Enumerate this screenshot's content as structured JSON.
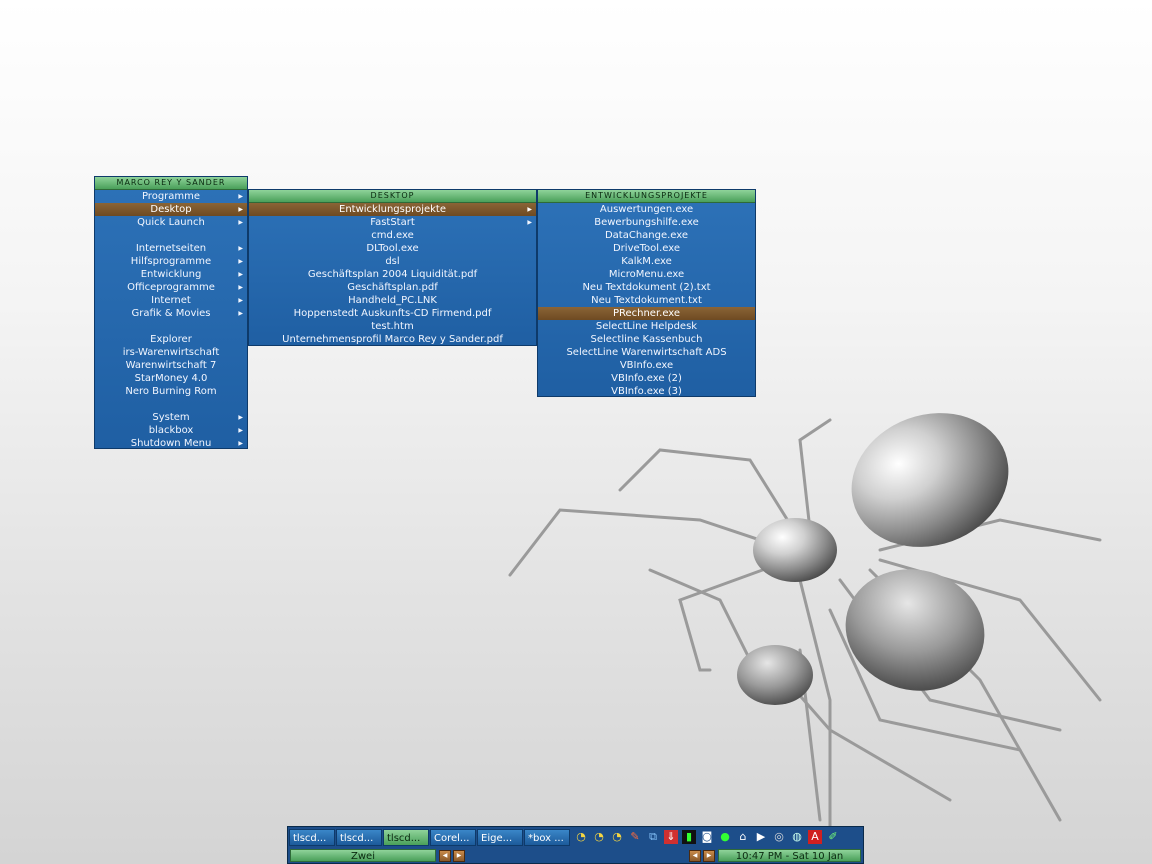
{
  "root_menu": {
    "title": "MARCO REY Y SANDER",
    "items": [
      {
        "label": "Programme",
        "submenu": true
      },
      {
        "label": "Desktop",
        "submenu": true
      },
      {
        "label": "Quick Launch",
        "submenu": true
      },
      {
        "label": "Internetseiten",
        "submenu": true
      },
      {
        "label": "Hilfsprogramme",
        "submenu": true
      },
      {
        "label": "Entwicklung",
        "submenu": true
      },
      {
        "label": "Officeprogramme",
        "submenu": true
      },
      {
        "label": "Internet",
        "submenu": true
      },
      {
        "label": "Grafik & Movies",
        "submenu": true
      },
      {
        "label": "Explorer"
      },
      {
        "label": "irs-Warenwirtschaft"
      },
      {
        "label": "Warenwirtschaft 7"
      },
      {
        "label": "StarMoney 4.0"
      },
      {
        "label": "Nero Burning Rom"
      },
      {
        "label": "System",
        "submenu": true
      },
      {
        "label": "blackbox",
        "submenu": true
      },
      {
        "label": "Shutdown Menu",
        "submenu": true
      }
    ]
  },
  "desktop_menu": {
    "title": "DESKTOP",
    "items": [
      {
        "label": "Entwicklungsprojekte",
        "submenu": true
      },
      {
        "label": "FastStart",
        "submenu": true
      },
      {
        "label": "cmd.exe"
      },
      {
        "label": "DLTool.exe"
      },
      {
        "label": "dsl"
      },
      {
        "label": "Geschäftsplan 2004 Liquidität.pdf"
      },
      {
        "label": "Geschäftsplan.pdf"
      },
      {
        "label": "Handheld_PC.LNK"
      },
      {
        "label": "Hoppenstedt Auskunfts-CD Firmend.pdf"
      },
      {
        "label": "test.htm"
      },
      {
        "label": "Unternehmensprofil Marco Rey y Sander.pdf"
      }
    ]
  },
  "projects_menu": {
    "title": "ENTWICKLUNGSPROJEKTE",
    "items": [
      {
        "label": "Auswertungen.exe"
      },
      {
        "label": "Bewerbungshilfe.exe"
      },
      {
        "label": "DataChange.exe"
      },
      {
        "label": "DriveTool.exe"
      },
      {
        "label": "KalkM.exe"
      },
      {
        "label": "MicroMenu.exe"
      },
      {
        "label": "Neu Textdokument (2).txt"
      },
      {
        "label": "Neu Textdokument.txt"
      },
      {
        "label": "PRechner.exe"
      },
      {
        "label": "SelectLine Helpdesk"
      },
      {
        "label": "Selectline Kassenbuch"
      },
      {
        "label": "SelectLine Warenwirtschaft ADS"
      },
      {
        "label": "VBInfo.exe"
      },
      {
        "label": "VBInfo.exe (2)"
      },
      {
        "label": "VBInfo.exe (3)"
      }
    ]
  },
  "taskbar": {
    "tasks": [
      "tlscd...",
      "tlscd...",
      "tlscd...",
      "Corel...",
      "Eige...",
      "*box ..."
    ],
    "workspace": "Zwei",
    "clock": "10:47 PM - Sat 10 Jan",
    "tray_icons": [
      "gauge-icon",
      "gauge-icon",
      "gauge-icon",
      "paint-icon",
      "network-icon",
      "download-icon",
      "meter-icon",
      "tape-icon",
      "traffic-light-icon",
      "home-lite-icon",
      "media-player-icon",
      "disc-icon",
      "cpu-icon",
      "acrobat-icon",
      "pen-icon"
    ]
  },
  "colors": {
    "menu_bg": "#2468ad",
    "title_bg": "#5fb06c",
    "selected_bg": "#7a5530"
  }
}
